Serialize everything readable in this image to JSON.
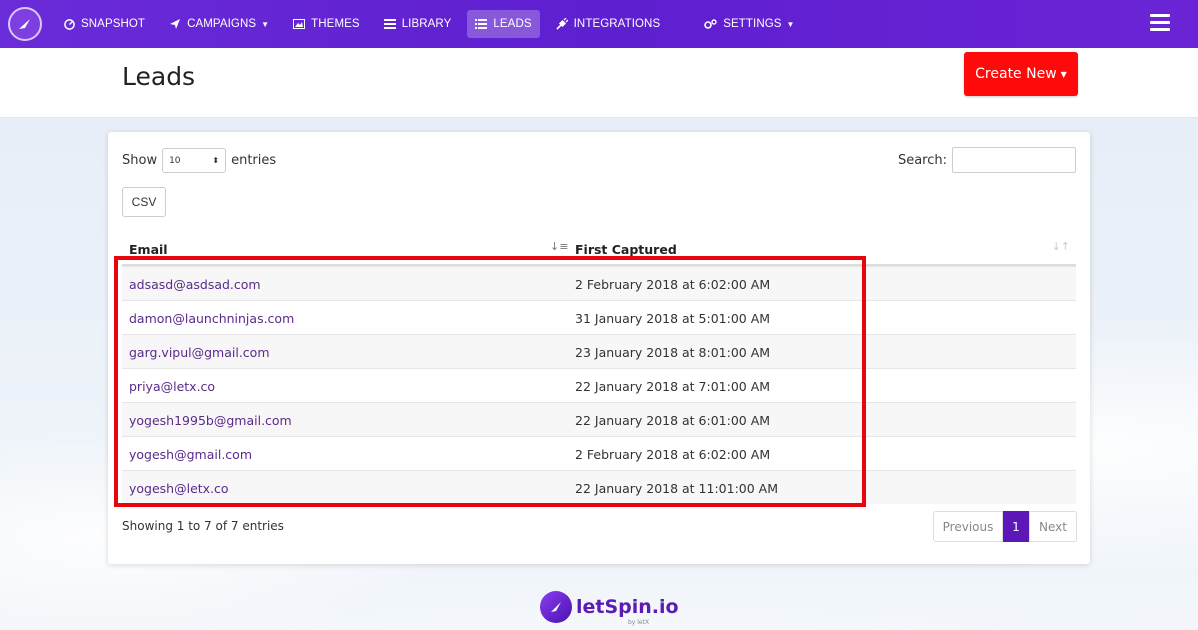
{
  "nav": {
    "items": [
      {
        "id": "snapshot",
        "label": "SNAPSHOT",
        "icon": "dashboard-icon"
      },
      {
        "id": "campaigns",
        "label": "CAMPAIGNS",
        "icon": "paper-plane-icon",
        "dropdown": true
      },
      {
        "id": "themes",
        "label": "THEMES",
        "icon": "image-icon"
      },
      {
        "id": "library",
        "label": "LIBRARY",
        "icon": "library-icon"
      },
      {
        "id": "leads",
        "label": "LEADS",
        "icon": "list-icon",
        "active": true
      },
      {
        "id": "integrations",
        "label": "INTEGRATIONS",
        "icon": "plug-icon"
      },
      {
        "id": "settings",
        "label": "SETTINGS",
        "icon": "cogs-icon",
        "dropdown": true
      }
    ]
  },
  "header": {
    "title": "Leads",
    "create_label": "Create New"
  },
  "controls": {
    "show_prefix": "Show",
    "show_value": "10",
    "show_suffix": "entries",
    "search_label": "Search:",
    "search_value": "",
    "csv_label": "CSV"
  },
  "table": {
    "columns": [
      "Email",
      "First Captured"
    ],
    "rows": [
      {
        "email": "adsasd@asdsad.com",
        "first_captured": "2 February 2018 at 6:02:00 AM"
      },
      {
        "email": "damon@launchninjas.com",
        "first_captured": "31 January 2018 at 5:01:00 AM"
      },
      {
        "email": "garg.vipul@gmail.com",
        "first_captured": "23 January 2018 at 8:01:00 AM"
      },
      {
        "email": "priya@letx.co",
        "first_captured": "22 January 2018 at 7:01:00 AM"
      },
      {
        "email": "yogesh1995b@gmail.com",
        "first_captured": "22 January 2018 at 6:01:00 AM"
      },
      {
        "email": "yogesh@gmail.com",
        "first_captured": "2 February 2018 at 6:02:00 AM"
      },
      {
        "email": "yogesh@letx.co",
        "first_captured": "22 January 2018 at 11:01:00 AM"
      }
    ]
  },
  "pagination": {
    "info": "Showing 1 to 7 of 7 entries",
    "previous": "Previous",
    "current": "1",
    "next": "Next"
  },
  "footer": {
    "brand": "letSpin.io",
    "by": "by letX"
  },
  "colors": {
    "nav_bg": "#6a2bd9",
    "create_button": "#ff0a0a",
    "highlight_border": "#e8050e",
    "page_active": "#5b17b8",
    "email_text": "#5a2b8a"
  }
}
